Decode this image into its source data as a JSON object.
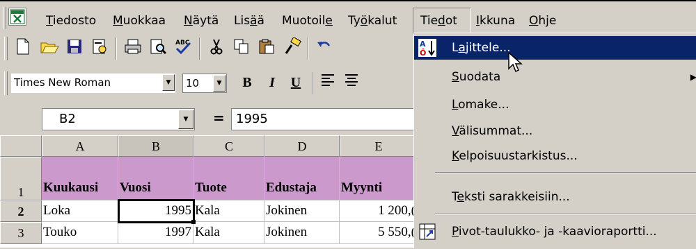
{
  "menubar": {
    "items": [
      {
        "label": "Tiedosto",
        "key": "T"
      },
      {
        "label": "Muokkaa",
        "key": "M"
      },
      {
        "label": "Näytä",
        "key": "N"
      },
      {
        "label": "Lisää",
        "key": "ä"
      },
      {
        "label": "Muotoile",
        "key": "e"
      },
      {
        "label": "Työkalut",
        "key": "ö"
      },
      {
        "label": "Tiedot",
        "key": "d"
      },
      {
        "label": "Ikkuna",
        "key": "I"
      },
      {
        "label": "Ohje",
        "key": "O"
      }
    ],
    "active": "Tiedot",
    "app_icon": "excel-icon"
  },
  "toolbar": {
    "icons": [
      "new-icon",
      "open-icon",
      "save-icon",
      "permission-icon",
      "print-icon",
      "print-preview-icon",
      "spelling-icon",
      "cut-icon",
      "copy-icon",
      "paste-icon",
      "format-painter-icon",
      "undo-icon"
    ],
    "font_name": "Times New Roman",
    "font_size": "10",
    "bold_label": "B",
    "italic_label": "I",
    "underline_label": "U"
  },
  "formula_bar": {
    "name_box": "B2",
    "equals": "=",
    "value": "1995"
  },
  "grid": {
    "columns": [
      "A",
      "B",
      "C",
      "D",
      "E"
    ],
    "rows": [
      {
        "num": "1",
        "cells": [
          "Kuukausi",
          "Vuosi",
          "Tuote",
          "Edustaja",
          "Myynti"
        ]
      },
      {
        "num": "2",
        "cells": [
          "Loka",
          "1995",
          "Kala",
          "Jokinen",
          "1 200,("
        ]
      },
      {
        "num": "3",
        "cells": [
          "Touko",
          "1997",
          "Kala",
          "Jokinen",
          "5 550,("
        ]
      }
    ],
    "selected_cell": "B2",
    "header_fill": "#cc99cc"
  },
  "dropdown": {
    "items": [
      {
        "label": "Lajittele...",
        "key": "a",
        "icon": "sort-ascending-icon",
        "highlighted": true
      },
      {
        "label": "Suodata",
        "key": "S",
        "submenu": true
      },
      {
        "label": "Lomake...",
        "key": "L"
      },
      {
        "label": "Välisummat...",
        "key": "V"
      },
      {
        "label": "Kelpoisuustarkistus...",
        "key": "K"
      },
      {
        "label": "Teksti sarakkeisiin...",
        "key": "e"
      },
      {
        "label": "Pivot-taulukko- ja -kaavioraportti...",
        "key": "P",
        "icon": "pivot-table-icon"
      }
    ],
    "highlight_color": "#0a246a"
  }
}
